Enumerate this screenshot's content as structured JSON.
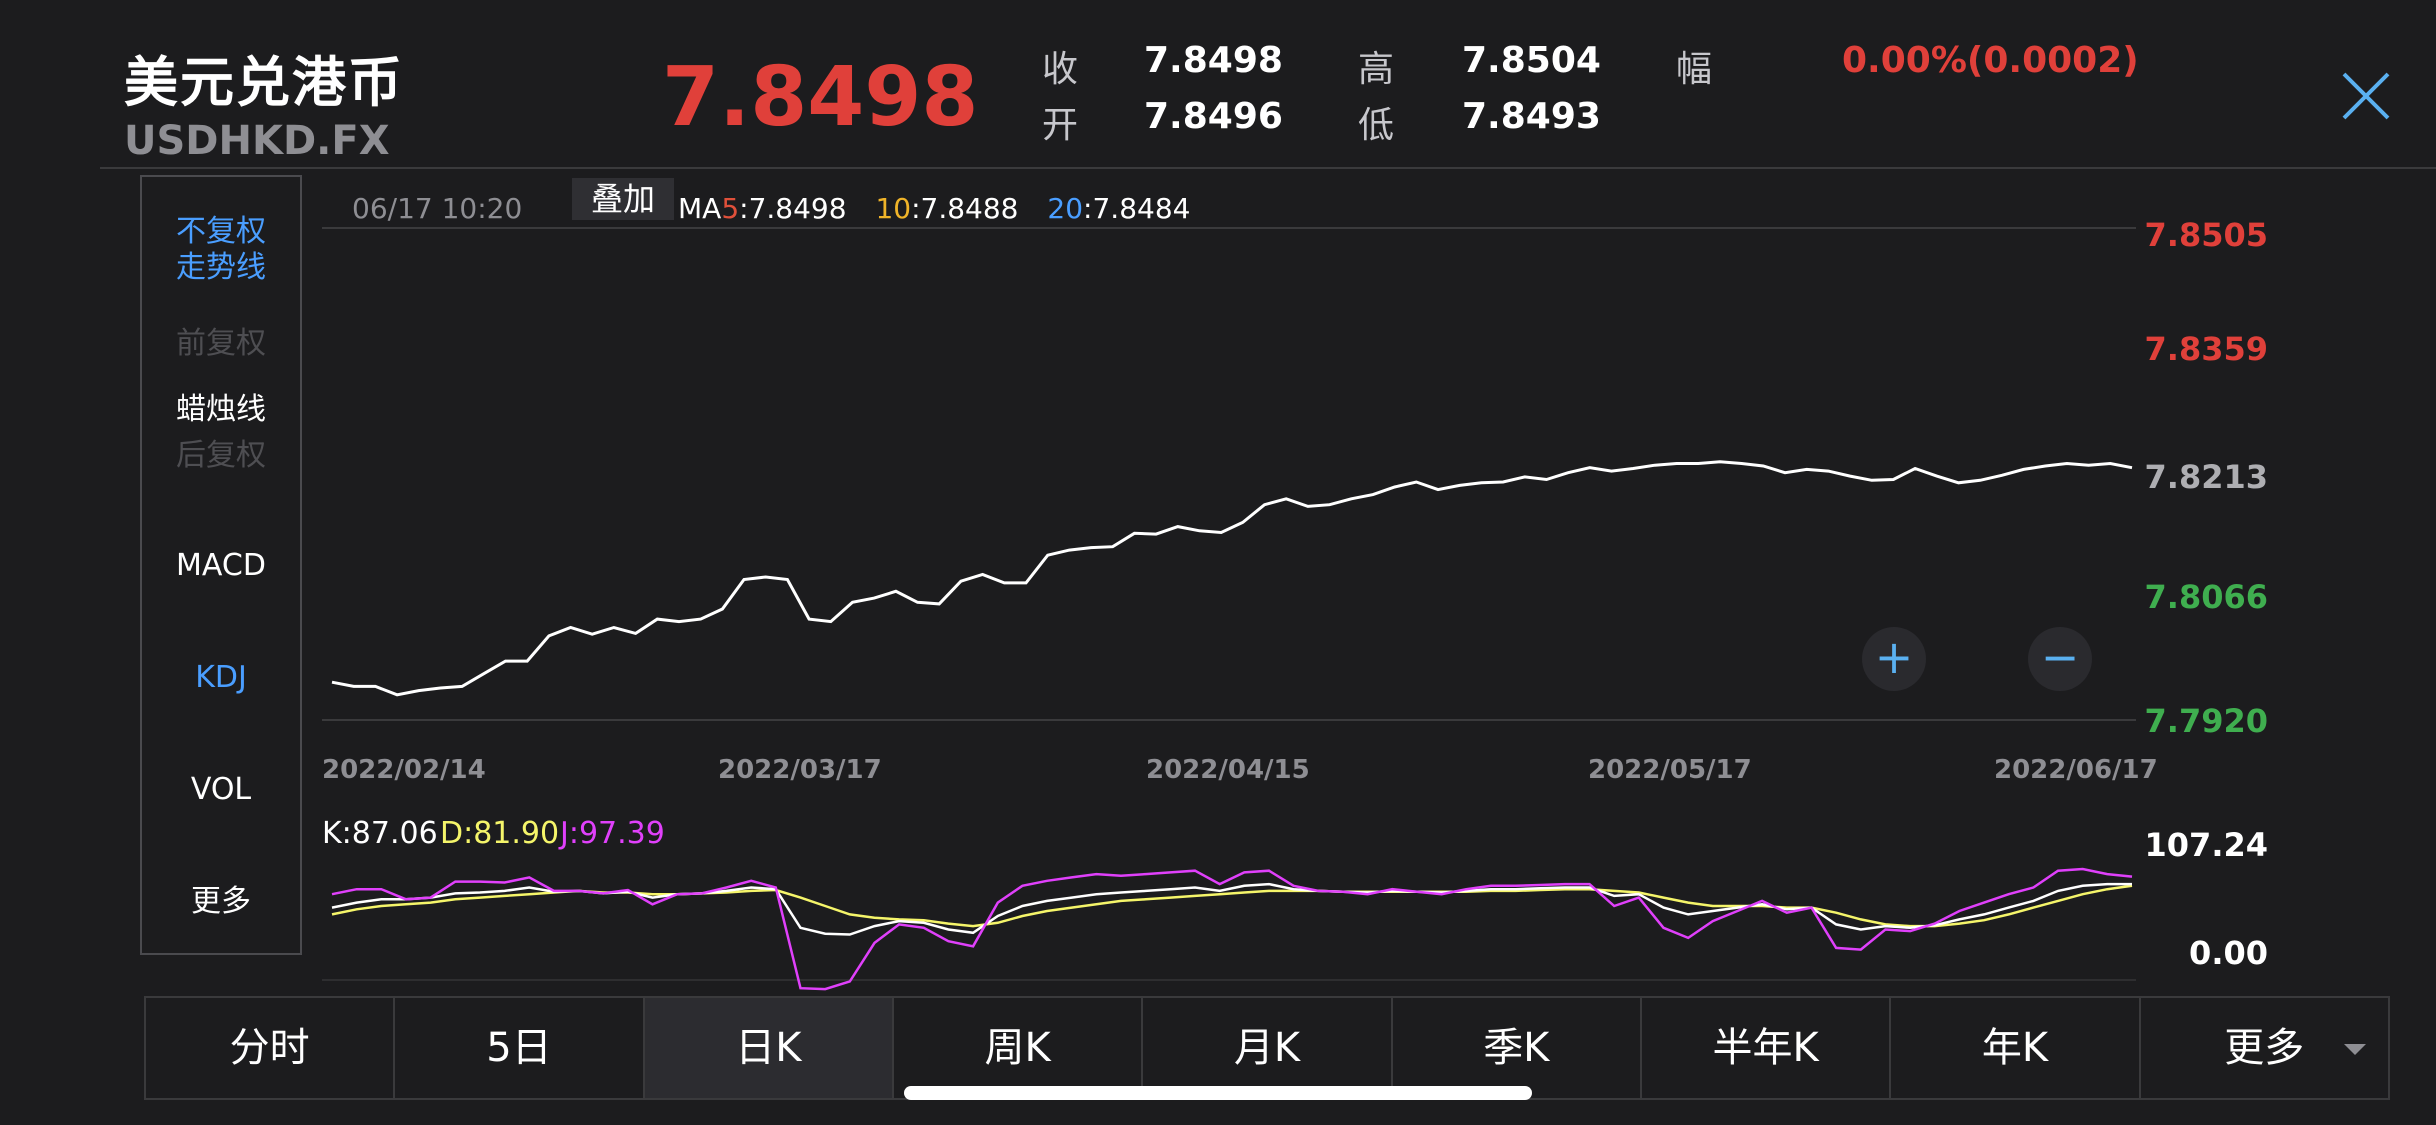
{
  "header": {
    "title": "美元兑港币",
    "ticker": "USDHKD.FX",
    "price": "7.8498",
    "quote": {
      "close_label": "收",
      "close_value": "7.8498",
      "open_label": "开",
      "open_value": "7.8496",
      "high_label": "高",
      "high_value": "7.8504",
      "low_label": "低",
      "low_value": "7.8493",
      "change_label": "幅",
      "change_value": "0.00%(0.0002)"
    }
  },
  "side_menu": {
    "adjust_none": "不复权",
    "trend_line": "走势线",
    "adjust_forward": "前复权",
    "candlestick": "蜡烛线",
    "adjust_backward": "后复权",
    "macd": "MACD",
    "kdj": "KDJ",
    "vol": "VOL",
    "more": "更多"
  },
  "chart_info": {
    "datetime": "06/17 10:20",
    "overlay_button": "叠加",
    "ma_prefix": "MA",
    "ma5_period": "5",
    "ma5_value": ":7.8498",
    "ma10_period": "10",
    "ma10_value": ":7.8488",
    "ma20_period": "20",
    "ma20_value": ":7.8484"
  },
  "kdj_info": {
    "k": "K:87.06",
    "d": "D:81.90",
    "j": "J:97.39",
    "axis_top": "107.24",
    "axis_bottom": "0.00"
  },
  "colors": {
    "ma5": "#e0503a",
    "ma10": "#f0b429",
    "ma20": "#4a9eff",
    "k_line": "#ffffff",
    "d_line": "#f5f56a",
    "j_line": "#e040fb",
    "up": "#e0403a",
    "down": "#3fae4f"
  },
  "zoom": {
    "in_icon": "+",
    "out_icon": "−"
  },
  "tabs": [
    "分时",
    "5日",
    "日K",
    "周K",
    "月K",
    "季K",
    "半年K",
    "年K",
    "更多"
  ],
  "active_tab": "日K",
  "chart_data": [
    {
      "type": "line",
      "x_ticks": [
        "2022/02/14",
        "2022/03/17",
        "2022/04/15",
        "2022/05/17",
        "2022/06/17"
      ],
      "y_ticks": [
        "7.8505",
        "7.8359",
        "7.8213",
        "7.8066",
        "7.7920"
      ],
      "ylim": [
        7.792,
        7.8505
      ],
      "series": [
        {
          "values": [
            7.7965,
            7.796,
            7.796,
            7.795,
            7.7955,
            7.7958,
            7.796,
            7.7975,
            7.799,
            7.799,
            7.802,
            7.803,
            7.8022,
            7.803,
            7.8023,
            7.804,
            7.8037,
            7.804,
            7.8052,
            7.8087,
            7.809,
            7.8087,
            7.804,
            7.8037,
            7.806,
            7.8065,
            7.8073,
            7.806,
            7.8058,
            7.8085,
            7.8093,
            7.8083,
            7.8083,
            7.8116,
            7.8122,
            7.8125,
            7.8126,
            7.8142,
            7.8141,
            7.815,
            7.8145,
            7.8143,
            7.8155,
            7.8176,
            7.8183,
            7.8174,
            7.8176,
            7.8183,
            7.8188,
            7.8197,
            7.8203,
            7.8194,
            7.8199,
            7.8202,
            7.8203,
            7.8209,
            7.8206,
            7.8214,
            7.822,
            7.8216,
            7.8219,
            7.8223,
            7.8225,
            7.8225,
            7.8227,
            7.8225,
            7.8222,
            7.8214,
            7.8218,
            7.8216,
            7.821,
            7.8205,
            7.8206,
            7.8219,
            7.821,
            7.8202,
            7.8205,
            7.8211,
            7.8218,
            7.8222,
            7.8225,
            7.8223,
            7.8225,
            7.822
          ]
        }
      ]
    },
    {
      "type": "line",
      "ylim": [
        0.0,
        107.24
      ],
      "y_ticks": [
        "107.24",
        "0.00"
      ],
      "series": [
        {
          "name": "K",
          "values": [
            60,
            66,
            70,
            70,
            72,
            77,
            78,
            80,
            84,
            79,
            80,
            77,
            79,
            72,
            76,
            77,
            80,
            84,
            82,
            36,
            29,
            28,
            38,
            44,
            42,
            34,
            30,
            50,
            62,
            68,
            72,
            76,
            78,
            80,
            82,
            84,
            80,
            86,
            88,
            82,
            80,
            79,
            78,
            80,
            79,
            78,
            80,
            82,
            82,
            83,
            84,
            84,
            74,
            76,
            60,
            52,
            56,
            60,
            64,
            58,
            60,
            40,
            34,
            38,
            36,
            39,
            46,
            52,
            60,
            68,
            80,
            86,
            88,
            88
          ]
        },
        {
          "name": "D",
          "values": [
            52,
            58,
            62,
            64,
            66,
            70,
            72,
            74,
            76,
            78,
            80,
            78,
            78,
            76,
            76,
            77,
            78,
            80,
            81,
            72,
            62,
            52,
            48,
            46,
            45,
            41,
            38,
            42,
            50,
            56,
            60,
            64,
            68,
            70,
            72,
            74,
            76,
            78,
            80,
            80,
            80,
            79,
            79,
            79,
            79,
            79,
            79,
            80,
            80,
            81,
            82,
            82,
            80,
            78,
            72,
            66,
            62,
            62,
            62,
            60,
            60,
            54,
            46,
            40,
            38,
            38,
            41,
            45,
            52,
            60,
            68,
            76,
            82,
            86
          ]
        },
        {
          "name": "J",
          "values": [
            76,
            82,
            82,
            70,
            72,
            91,
            91,
            90,
            96,
            80,
            80,
            77,
            81,
            64,
            76,
            77,
            84,
            92,
            84,
            -36,
            -37,
            -28,
            18,
            40,
            36,
            20,
            14,
            66,
            86,
            92,
            96,
            100,
            98,
            100,
            102,
            104,
            88,
            102,
            104,
            86,
            80,
            79,
            76,
            82,
            79,
            76,
            82,
            86,
            86,
            87,
            88,
            88,
            62,
            72,
            36,
            24,
            44,
            56,
            68,
            54,
            60,
            12,
            10,
            34,
            32,
            41,
            56,
            66,
            76,
            84,
            104,
            106,
            100,
            97
          ]
        }
      ]
    }
  ]
}
